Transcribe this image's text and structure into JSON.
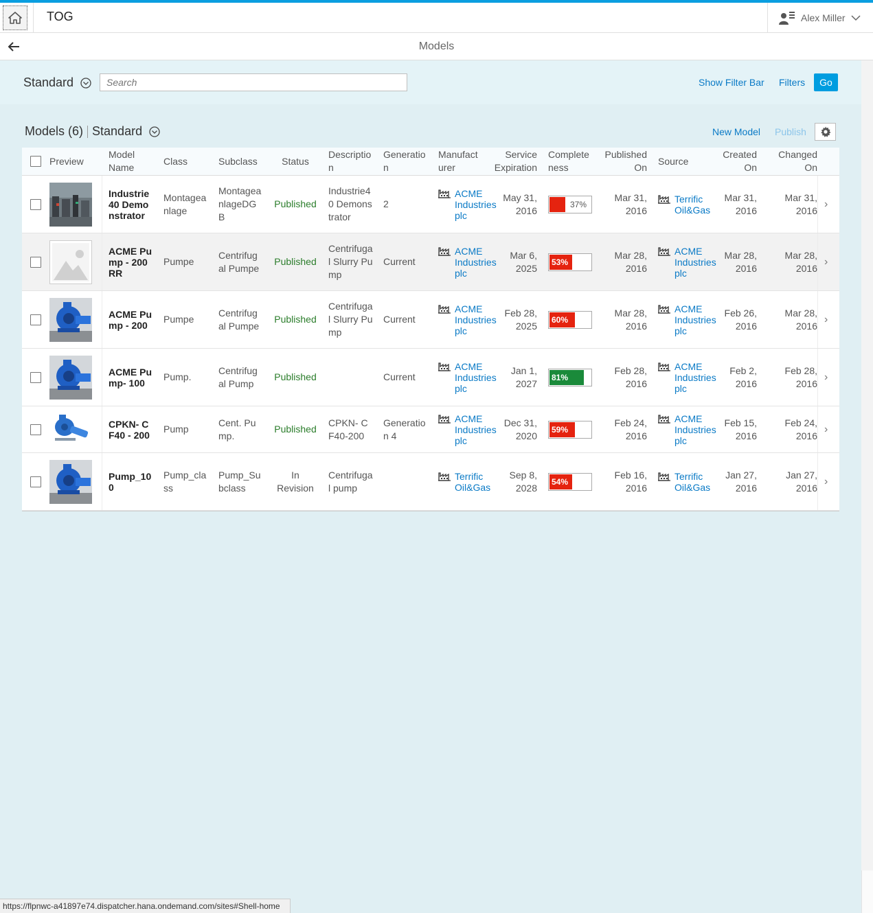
{
  "shell": {
    "app_title": "TOG",
    "user_name": "Alex Miller"
  },
  "header": {
    "page_title": "Models"
  },
  "filter_bar": {
    "variant": "Standard",
    "search_placeholder": "Search",
    "show_filter_bar": "Show Filter Bar",
    "filters": "Filters",
    "go": "Go"
  },
  "table_toolbar": {
    "title": "Models (6)",
    "variant": "Standard",
    "new_model": "New Model",
    "publish": "Publish"
  },
  "columns": [
    "Preview",
    "Model Name",
    "Class",
    "Subclass",
    "Status",
    "Description",
    "Generation",
    "Manufacturer",
    "Service Expiration",
    "Completeness",
    "Published On",
    "Source",
    "Created On",
    "Changed On"
  ],
  "rows": [
    {
      "preview": "photo-industrial-plant",
      "name": "Industrie 40 Demonstrator",
      "class": "Montageanlage",
      "subclass": "MontageanlageDGB",
      "status": "Published",
      "description": "Industrie40 Demonstrator",
      "generation": "2",
      "manufacturer": "ACME Industries plc",
      "service_expiration": "May 31, 2016",
      "completeness": 37,
      "completeness_label": "37%",
      "completeness_color": "#e5230f",
      "published_on": "Mar 31, 2016",
      "source": "Terrific Oil&Gas",
      "created_on": "Mar 31, 2016",
      "changed_on": "Mar 31, 2016"
    },
    {
      "preview": "placeholder-image",
      "name": "ACME Pump - 200 RR",
      "class": "Pumpe",
      "subclass": "Centrifugal Pumpe",
      "status": "Published",
      "description": "Centrifugal Slurry Pump",
      "generation": "Current",
      "manufacturer": "ACME Industries plc",
      "service_expiration": "Mar 6, 2025",
      "completeness": 53,
      "completeness_label": "53%",
      "completeness_color": "#e5230f",
      "published_on": "Mar 28, 2016",
      "source": "ACME Industries plc",
      "created_on": "Mar 28, 2016",
      "changed_on": "Mar 28, 2016"
    },
    {
      "preview": "photo-blue-pump",
      "name": "ACME Pump - 200",
      "class": "Pumpe",
      "subclass": "Centrifugal Pumpe",
      "status": "Published",
      "description": "Centrifugal Slurry Pump",
      "generation": "Current",
      "manufacturer": "ACME Industries plc",
      "service_expiration": "Feb 28, 2025",
      "completeness": 60,
      "completeness_label": "60%",
      "completeness_color": "#e5230f",
      "published_on": "Mar 28, 2016",
      "source": "ACME Industries plc",
      "created_on": "Feb 26, 2016",
      "changed_on": "Mar 28, 2016"
    },
    {
      "preview": "photo-blue-pump",
      "name": "ACME Pump- 100",
      "class": "Pump.",
      "subclass": "Centrifugal Pump",
      "status": "Published",
      "description": "",
      "generation": "Current",
      "manufacturer": "ACME Industries plc",
      "service_expiration": "Jan 1, 2027",
      "completeness": 81,
      "completeness_label": "81%",
      "completeness_color": "#1a8a3a",
      "published_on": "Feb 28, 2016",
      "source": "ACME Industries plc",
      "created_on": "Feb 2, 2016",
      "changed_on": "Feb 28, 2016"
    },
    {
      "preview": "photo-small-pump",
      "name": "CPKN- CF40 - 200",
      "class": "Pump",
      "subclass": "Cent. Pump.",
      "status": "Published",
      "description": "CPKN- CF40-200",
      "generation": "Generation 4",
      "manufacturer": "ACME Industries plc",
      "service_expiration": "Dec 31, 2020",
      "completeness": 59,
      "completeness_label": "59%",
      "completeness_color": "#e5230f",
      "published_on": "Feb 24, 2016",
      "source": "ACME Industries plc",
      "created_on": "Feb 15, 2016",
      "changed_on": "Feb 24, 2016"
    },
    {
      "preview": "photo-blue-pump",
      "name": "Pump_100",
      "class": "Pump_class",
      "subclass": "Pump_Subclass",
      "status": "In Revision",
      "description": "Centrifugal pump",
      "generation": "",
      "manufacturer": "Terrific Oil&Gas",
      "service_expiration": "Sep 8, 2028",
      "completeness": 54,
      "completeness_label": "54%",
      "completeness_color": "#e5230f",
      "published_on": "Feb 16, 2016",
      "source": "Terrific Oil&Gas",
      "created_on": "Jan 27, 2016",
      "changed_on": "Jan 27, 2016"
    }
  ],
  "status_url": "https://flpnwc-a41897e74.dispatcher.hana.ondemand.com/sites#Shell-home"
}
